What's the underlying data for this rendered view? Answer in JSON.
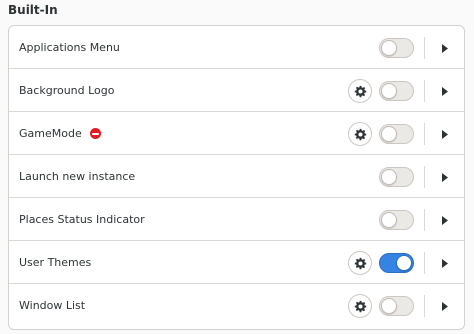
{
  "section": {
    "title": "Built-In"
  },
  "colors": {
    "accent": "#3584e4",
    "error": "#e01b24"
  },
  "extensions": [
    {
      "name": "Applications Menu",
      "enabled": false,
      "has_settings": false,
      "has_error": false
    },
    {
      "name": "Background Logo",
      "enabled": false,
      "has_settings": true,
      "has_error": false
    },
    {
      "name": "GameMode",
      "enabled": false,
      "has_settings": true,
      "has_error": true
    },
    {
      "name": "Launch new instance",
      "enabled": false,
      "has_settings": false,
      "has_error": false
    },
    {
      "name": "Places Status Indicator",
      "enabled": false,
      "has_settings": false,
      "has_error": false
    },
    {
      "name": "User Themes",
      "enabled": true,
      "has_settings": true,
      "has_error": false
    },
    {
      "name": "Window List",
      "enabled": false,
      "has_settings": true,
      "has_error": false
    }
  ]
}
